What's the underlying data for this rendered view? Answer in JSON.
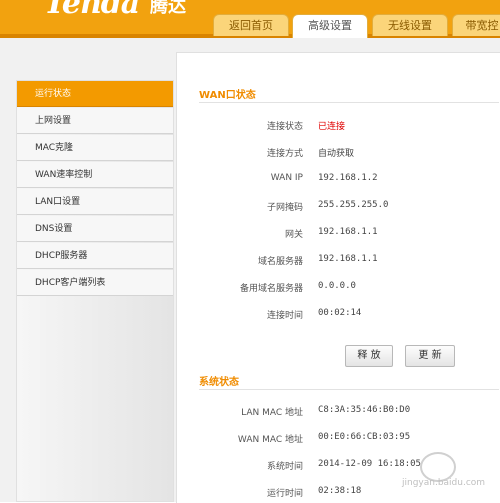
{
  "brand": {
    "logo_text": "Tenda",
    "logo_cn": "腾达"
  },
  "tabs": [
    {
      "label": "返回首页"
    },
    {
      "label": "高级设置"
    },
    {
      "label": "无线设置"
    },
    {
      "label": "带宽控"
    }
  ],
  "sidebar": {
    "items": [
      {
        "label": "运行状态"
      },
      {
        "label": "上网设置"
      },
      {
        "label": "MAC克隆"
      },
      {
        "label": "WAN速率控制"
      },
      {
        "label": "LAN口设置"
      },
      {
        "label": "DNS设置"
      },
      {
        "label": "DHCP服务器"
      },
      {
        "label": "DHCP客户端列表"
      }
    ]
  },
  "wan": {
    "title": "WAN口状态",
    "rows": [
      {
        "label": "连接状态",
        "value": "已连接"
      },
      {
        "label": "连接方式",
        "value": "自动获取"
      },
      {
        "label": "WAN IP",
        "value": "192.168.1.2"
      },
      {
        "label": "子网掩码",
        "value": "255.255.255.0"
      },
      {
        "label": "网关",
        "value": "192.168.1.1"
      },
      {
        "label": "域名服务器",
        "value": "192.168.1.1"
      },
      {
        "label": "备用域名服务器",
        "value": "0.0.0.0"
      },
      {
        "label": "连接时间",
        "value": "00:02:14"
      }
    ],
    "release_label": "释 放",
    "renew_label": "更 新"
  },
  "system": {
    "title": "系统状态",
    "rows": [
      {
        "label": "LAN MAC 地址",
        "value": "C8:3A:35:46:B0:D0"
      },
      {
        "label": "WAN MAC 地址",
        "value": "00:E0:66:CB:03:95"
      },
      {
        "label": "系统时间",
        "value": "2014-12-09 16:18:05"
      },
      {
        "label": "运行时间",
        "value": "02:38:18"
      }
    ]
  },
  "watermark": {
    "text": "jingyan.baidu.com"
  },
  "colors": {
    "accent": "#f39a00",
    "header": "#f2a20f",
    "connected": "#e00000"
  }
}
